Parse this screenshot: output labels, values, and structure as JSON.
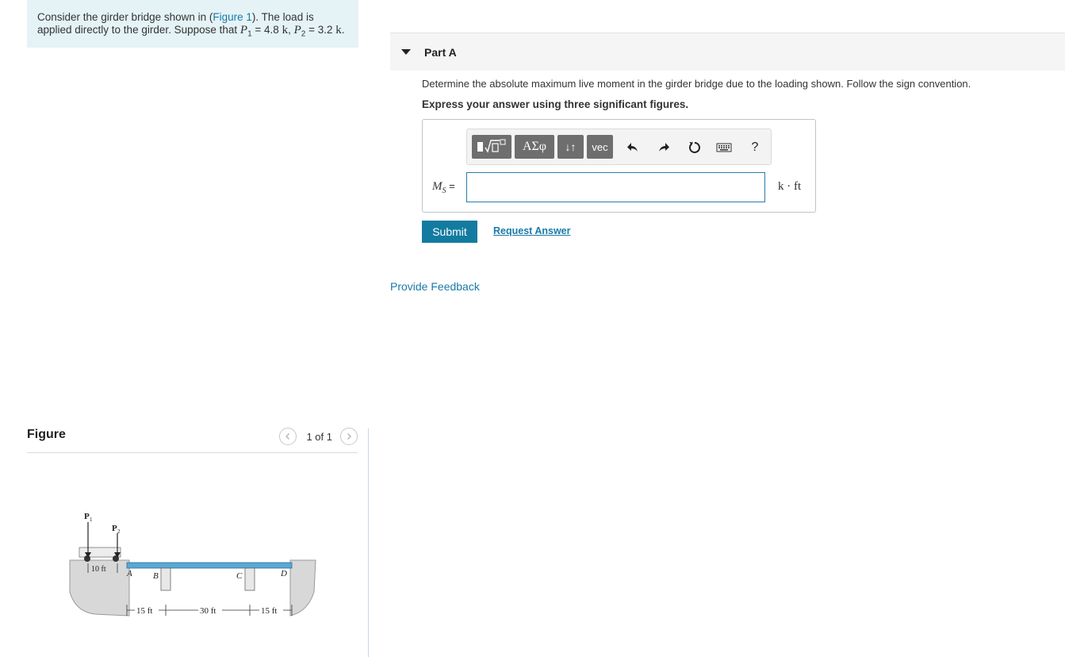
{
  "problem": {
    "text_before": "Consider the girder bridge shown in (",
    "figure_link": "Figure 1",
    "text_middle": "). The load is applied directly to the girder. Suppose that ",
    "p1_symbol": "P",
    "p1_sub": "1",
    "p1_value": " = 4.8 ",
    "p1_unit": "k",
    "separator": ", ",
    "p2_symbol": "P",
    "p2_sub": "2",
    "p2_value": " = 3.2 ",
    "p2_unit": "k",
    "end": "."
  },
  "figure": {
    "title": "Figure",
    "pager_text": "1 of 1",
    "prev_icon": "chevron-left-icon",
    "next_icon": "chevron-right-icon",
    "labels": {
      "p1": "P",
      "p1_sub": "1",
      "p2": "P",
      "p2_sub": "2",
      "truck_spacing": "10 ft",
      "a": "A",
      "b": "B",
      "c": "C",
      "d": "D",
      "span_ab": "15 ft",
      "span_bc": "30 ft",
      "span_cd": "15 ft"
    }
  },
  "part": {
    "title": "Part A",
    "question": "Determine the absolute maximum live moment in the girder bridge due to the loading shown. Follow the sign convention.",
    "instruction": "Express your answer using three significant figures."
  },
  "toolbar": {
    "templates_icon": "templates-icon",
    "greek_label": "ΑΣφ",
    "arrows_label": "↓↑",
    "vec_label": "vec",
    "undo_icon": "undo-icon",
    "redo_icon": "redo-icon",
    "reset_icon": "reset-icon",
    "keyboard_icon": "keyboard-icon",
    "help_label": "?"
  },
  "answer": {
    "label_symbol": "M",
    "label_sub": "S",
    "label_eq": " =",
    "value": "",
    "unit": "k · ft"
  },
  "actions": {
    "submit_label": "Submit",
    "request_label": "Request Answer",
    "feedback_label": "Provide Feedback"
  },
  "colors": {
    "accent": "#137ba0",
    "link": "#1a7aa8",
    "problem_bg": "#e5f3f6",
    "toolbar_button": "#6e6e6e"
  }
}
